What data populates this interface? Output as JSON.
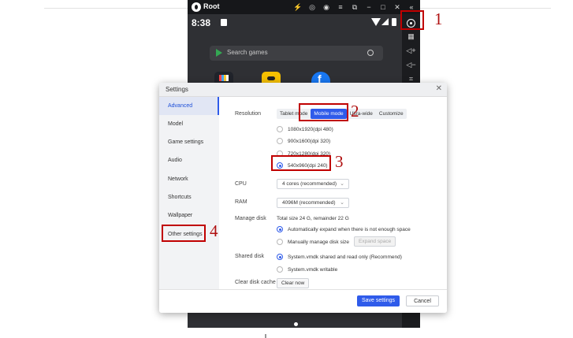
{
  "emulator": {
    "title": "Root",
    "time": "8:38",
    "search_placeholder": "Search games",
    "titlebar_icons": [
      "lightning-icon",
      "gamepad-icon",
      "account-icon",
      "menu-icon",
      "minimize-window-icon",
      "minimize-icon",
      "maximize-icon",
      "close-icon",
      "collapse-icon"
    ],
    "titlebar_glyphs": [
      "⚡",
      "◎",
      "◉",
      "≡",
      "⧉",
      "−",
      "□",
      "✕",
      "«"
    ],
    "sidebar_icons": [
      "settings-gear-icon",
      "keyboard-icon",
      "volume-up-icon",
      "volume-down-icon",
      "screenshot-icon"
    ],
    "sidebar_glyphs": [
      "",
      "▦",
      "◁+",
      "◁−",
      "⌗"
    ]
  },
  "dialog": {
    "title": "Settings",
    "close": "✕",
    "nav": [
      "Advanced",
      "Model",
      "Game settings",
      "Audio",
      "Network",
      "Shortcuts",
      "Wallpaper",
      "Other settings"
    ],
    "active_nav": "Advanced",
    "resolution": {
      "label": "Resolution",
      "modes": [
        "Tablet mode",
        "Mobile mode",
        "Ultra-wide",
        "Customize"
      ],
      "selected_mode": "Mobile mode",
      "options": [
        "1080x1920(dpi 480)",
        "900x1600(dpi 320)",
        "720x1280(dpi 320)",
        "540x960(dpi 240)"
      ],
      "selected_option": "540x960(dpi 240)"
    },
    "cpu": {
      "label": "CPU",
      "value": "4 cores (recommended)"
    },
    "ram": {
      "label": "RAM",
      "value": "4096M (recommended)"
    },
    "manage_disk": {
      "label": "Manage disk",
      "summary": "Total size 24 G, remainder 22 G",
      "options": [
        "Automatically expand when there is not enough space",
        "Manually manage disk size"
      ],
      "selected": "Automatically expand when there is not enough space",
      "expand_button": "Expand space"
    },
    "shared_disk": {
      "label": "Shared disk",
      "options": [
        "System.vmdk shared and read only (Recommend)",
        "System.vmdk writable"
      ],
      "selected": "System.vmdk shared and read only (Recommend)"
    },
    "clear_cache": {
      "label": "Clear disk cache",
      "button": "Clear now"
    },
    "save_button": "Save settings",
    "cancel_button": "Cancel"
  },
  "annotations": {
    "colors": {
      "box": "#c00000",
      "number": "#b01010"
    },
    "numbers": [
      "1",
      "2",
      "3",
      "4"
    ]
  },
  "colors": {
    "accent": "#2f5bea",
    "emulator_bg": "#2b2d31",
    "titlebar": "#16171a"
  }
}
